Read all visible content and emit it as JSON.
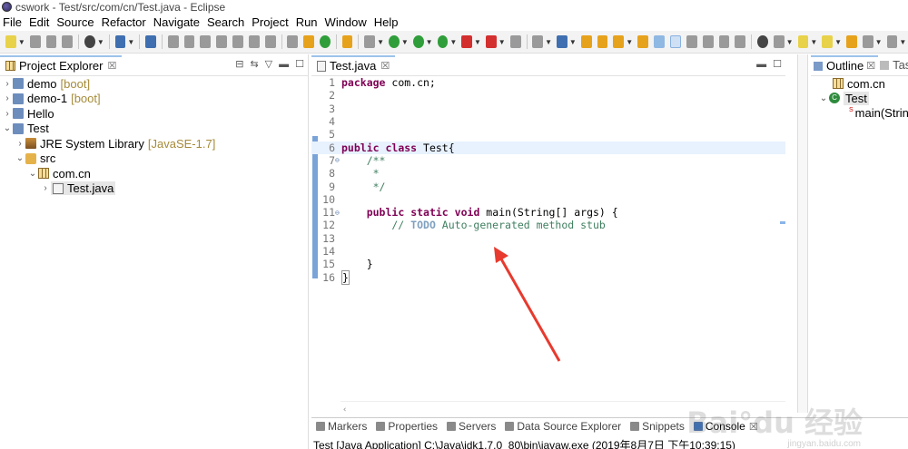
{
  "window": {
    "title": "cswork - Test/src/com/cn/Test.java - Eclipse"
  },
  "menubar": [
    "File",
    "Edit",
    "Source",
    "Refactor",
    "Navigate",
    "Search",
    "Project",
    "Run",
    "Window",
    "Help"
  ],
  "project_explorer": {
    "title": "Project Explorer",
    "close": "☒",
    "tree": [
      {
        "label": "demo",
        "suffix": "[boot]",
        "arrow": "›",
        "icon": "project"
      },
      {
        "label": "demo-1",
        "suffix": "[boot]",
        "arrow": "›",
        "icon": "project"
      },
      {
        "label": "Hello",
        "suffix": "",
        "arrow": "›",
        "icon": "project"
      },
      {
        "label": "Test",
        "suffix": "",
        "arrow": "⌄",
        "icon": "project"
      },
      {
        "label": "JRE System Library",
        "suffix": "[JavaSE-1.7]",
        "arrow": "›",
        "icon": "jre"
      },
      {
        "label": "src",
        "suffix": "",
        "arrow": "⌄",
        "icon": "src"
      },
      {
        "label": "com.cn",
        "suffix": "",
        "arrow": "⌄",
        "icon": "package"
      },
      {
        "label": "Test.java",
        "suffix": "",
        "arrow": "›",
        "icon": "file"
      }
    ]
  },
  "editor": {
    "tab_label": "Test.java",
    "close": "☒",
    "lines": [
      {
        "n": "1",
        "t": "package com.cn;"
      },
      {
        "n": "2",
        "t": ""
      },
      {
        "n": "3",
        "t": ""
      },
      {
        "n": "4",
        "t": ""
      },
      {
        "n": "5",
        "t": ""
      },
      {
        "n": "6",
        "t": "public class Test{"
      },
      {
        "n": "7",
        "t": "    /**"
      },
      {
        "n": "8",
        "t": "     *"
      },
      {
        "n": "9",
        "t": "     */"
      },
      {
        "n": "10",
        "t": ""
      },
      {
        "n": "11",
        "t": "    public static void main(String[] args) {"
      },
      {
        "n": "12",
        "t": "        // TODO Auto-generated method stub"
      },
      {
        "n": "13",
        "t": ""
      },
      {
        "n": "14",
        "t": ""
      },
      {
        "n": "15",
        "t": "    }"
      },
      {
        "n": "16",
        "t": "}"
      }
    ]
  },
  "outline": {
    "title": "Outline",
    "close": "☒",
    "other_tab": "Tas",
    "items": [
      {
        "label": "com.cn"
      },
      {
        "label": "Test"
      },
      {
        "label": "main(Strin"
      }
    ],
    "method_modifier": "S"
  },
  "bottom_tabs": [
    "Markers",
    "Properties",
    "Servers",
    "Data Source Explorer",
    "Snippets",
    "Console"
  ],
  "console": {
    "close": "☒",
    "text": "Test [Java Application] C:\\Java\\jdk1.7.0_80\\bin\\javaw.exe (2019年8月7日 下午10:39:15)"
  },
  "watermark": {
    "text": "Bai°du 经验",
    "sub": "jingyan.baidu.com"
  },
  "colors": {
    "keyword": "#7f0055",
    "comment": "#3f7f5f",
    "accent": "#9cc3ea",
    "annotation_arrow": "#e83a2e"
  }
}
